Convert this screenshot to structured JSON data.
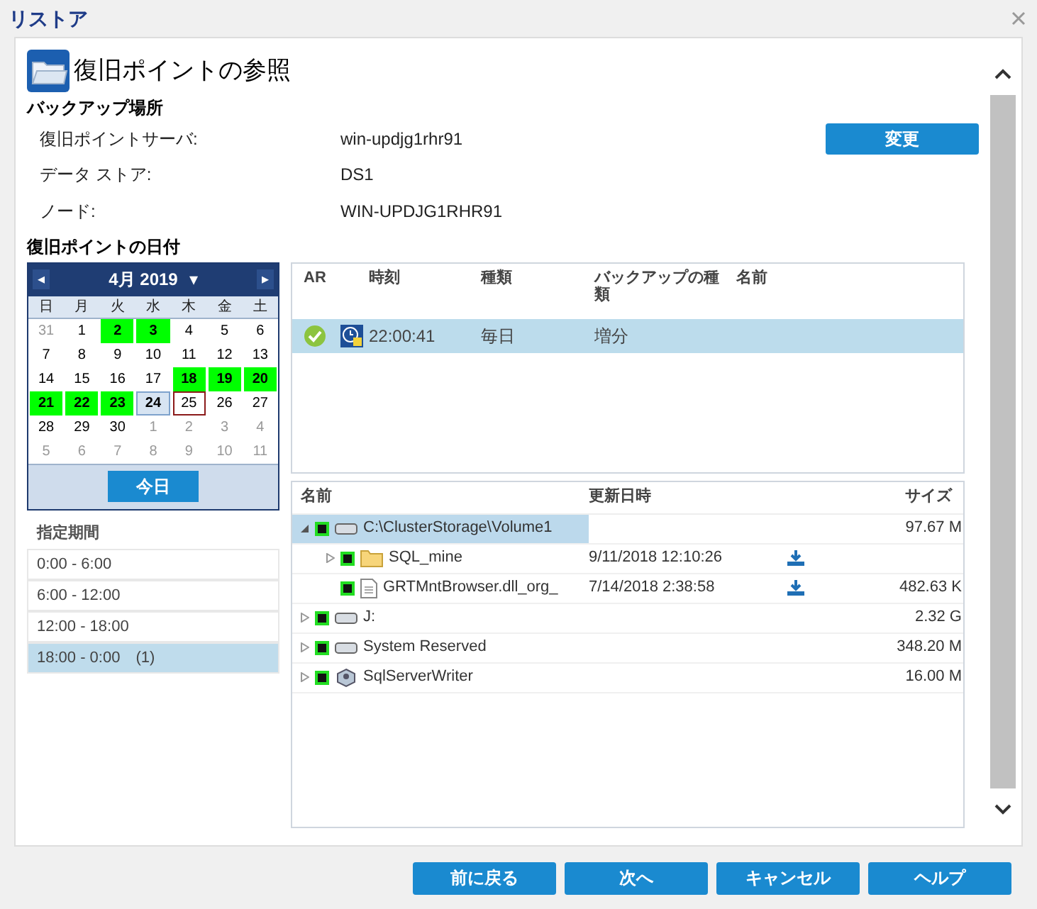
{
  "window": {
    "title": "リストア"
  },
  "heading": "復旧ポイントの参照",
  "backup_location": {
    "title": "バックアップ場所",
    "fields": [
      {
        "label": "復旧ポイントサーバ:",
        "value": "win-updjg1rhr91"
      },
      {
        "label": "データ ストア:",
        "value": "DS1"
      },
      {
        "label": "ノード:",
        "value": "WIN-UPDJG1RHR91"
      }
    ],
    "change_button": "変更"
  },
  "date_section": {
    "title": "復旧ポイントの日付"
  },
  "calendar": {
    "month": "4月 2019",
    "prev": "◂",
    "next": "▸",
    "menu": "▾",
    "weekdays": [
      "日",
      "月",
      "火",
      "水",
      "木",
      "金",
      "土"
    ],
    "days": [
      {
        "day": "31",
        "kind": "other",
        "selected": false
      },
      {
        "day": "1",
        "kind": "plain",
        "selected": false
      },
      {
        "day": "2",
        "kind": "backup",
        "selected": false
      },
      {
        "day": "3",
        "kind": "backup",
        "selected": false
      },
      {
        "day": "4",
        "kind": "plain",
        "selected": false
      },
      {
        "day": "5",
        "kind": "plain",
        "selected": false
      },
      {
        "day": "6",
        "kind": "plain",
        "selected": false
      },
      {
        "day": "7",
        "kind": "plain",
        "selected": false
      },
      {
        "day": "8",
        "kind": "plain",
        "selected": false
      },
      {
        "day": "9",
        "kind": "plain",
        "selected": false
      },
      {
        "day": "10",
        "kind": "plain",
        "selected": false
      },
      {
        "day": "11",
        "kind": "plain",
        "selected": false
      },
      {
        "day": "12",
        "kind": "plain",
        "selected": false
      },
      {
        "day": "13",
        "kind": "plain",
        "selected": false
      },
      {
        "day": "14",
        "kind": "plain",
        "selected": false
      },
      {
        "day": "15",
        "kind": "plain",
        "selected": false
      },
      {
        "day": "16",
        "kind": "plain",
        "selected": false
      },
      {
        "day": "17",
        "kind": "plain",
        "selected": false
      },
      {
        "day": "18",
        "kind": "backup",
        "selected": false
      },
      {
        "day": "19",
        "kind": "backup",
        "selected": false
      },
      {
        "day": "20",
        "kind": "backup",
        "selected": false
      },
      {
        "day": "21",
        "kind": "backup",
        "selected": false
      },
      {
        "day": "22",
        "kind": "backup",
        "selected": false
      },
      {
        "day": "23",
        "kind": "backup",
        "selected": false
      },
      {
        "day": "24",
        "kind": "backup",
        "selected": true
      },
      {
        "day": "25",
        "kind": "today",
        "selected": false
      },
      {
        "day": "26",
        "kind": "plain",
        "selected": false
      },
      {
        "day": "27",
        "kind": "plain",
        "selected": false
      },
      {
        "day": "28",
        "kind": "plain",
        "selected": false
      },
      {
        "day": "29",
        "kind": "plain",
        "selected": false
      },
      {
        "day": "30",
        "kind": "plain",
        "selected": false
      },
      {
        "day": "1",
        "kind": "other",
        "selected": false
      },
      {
        "day": "2",
        "kind": "other",
        "selected": false
      },
      {
        "day": "3",
        "kind": "other",
        "selected": false
      },
      {
        "day": "4",
        "kind": "other",
        "selected": false
      },
      {
        "day": "5",
        "kind": "other",
        "selected": false
      },
      {
        "day": "6",
        "kind": "other",
        "selected": false
      },
      {
        "day": "7",
        "kind": "other",
        "selected": false
      },
      {
        "day": "8",
        "kind": "other",
        "selected": false
      },
      {
        "day": "9",
        "kind": "other",
        "selected": false
      },
      {
        "day": "10",
        "kind": "other",
        "selected": false
      },
      {
        "day": "11",
        "kind": "other",
        "selected": false
      }
    ],
    "today_button": "今日"
  },
  "time_ranges": {
    "title": "指定期間",
    "items": [
      {
        "label": "0:00 - 6:00",
        "selected": false
      },
      {
        "label": "6:00 - 12:00",
        "selected": false
      },
      {
        "label": "12:00 - 18:00",
        "selected": false
      },
      {
        "label": "18:00 - 0:00　(1)",
        "selected": true
      }
    ]
  },
  "recovery_points": {
    "columns": [
      "AR",
      "時刻",
      "種類",
      "バックアップの種類",
      "名前"
    ],
    "rows": [
      {
        "time": "22:00:41",
        "type": "毎日",
        "backup_type": "増分",
        "selected": true
      }
    ]
  },
  "tree": {
    "columns": [
      "名前",
      "更新日時",
      "サイズ"
    ],
    "items": [
      {
        "name": "C:\\ClusterStorage\\Volume1",
        "kind": "drive",
        "size": "97.67 M",
        "expanded": true,
        "selected": true,
        "children": [
          {
            "name": "SQL_mine",
            "kind": "folder",
            "modified": "9/11/2018 12:10:26",
            "download": true,
            "expanded": false,
            "selected": false
          },
          {
            "name": "GRTMntBrowser.dll_org_",
            "kind": "file",
            "modified": "7/14/2018 2:38:58",
            "download": true,
            "size": "482.63 K",
            "selected": false
          }
        ]
      },
      {
        "name": "J:",
        "kind": "drive",
        "size": "2.32 G",
        "expanded": false,
        "selected": false
      },
      {
        "name": "System Reserved",
        "kind": "drive",
        "size": "348.20 M",
        "expanded": false,
        "selected": false
      },
      {
        "name": "SqlServerWriter",
        "kind": "writer",
        "size": "16.00 M",
        "expanded": false,
        "selected": false
      }
    ]
  },
  "footer_buttons": [
    "前に戻る",
    "次へ",
    "キャンセル",
    "ヘルプ"
  ]
}
